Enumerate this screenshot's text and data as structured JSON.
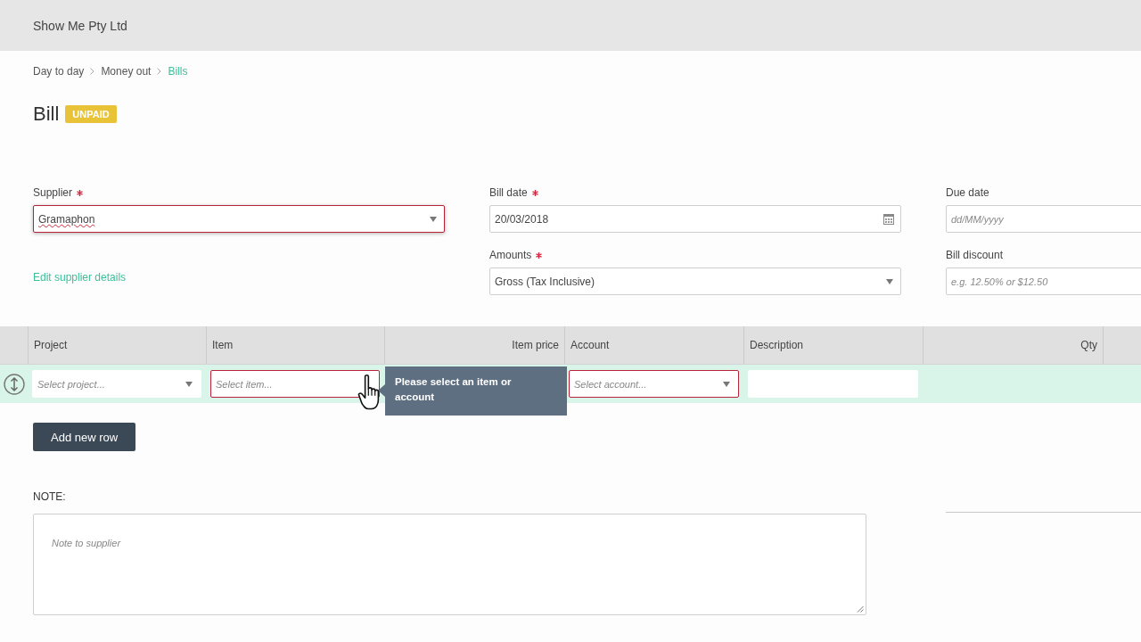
{
  "header": {
    "company": "Show Me Pty Ltd"
  },
  "breadcrumb": [
    {
      "label": "Day to day",
      "current": false
    },
    {
      "label": "Money out",
      "current": false
    },
    {
      "label": "Bills",
      "current": true
    }
  ],
  "title": "Bill",
  "status_badge": "UNPAID",
  "supplier": {
    "label": "Supplier",
    "required": true,
    "value": "Gramaphon",
    "invalid": true,
    "focused": true,
    "misspelled": true
  },
  "edit_supplier_link": "Edit supplier details",
  "details": [
    {
      "label": "Bill date",
      "required": true,
      "kind": "date",
      "value": "20/03/2018"
    },
    {
      "label": "Due date",
      "kind": "text",
      "placeholder": "dd/MM/yyyy"
    },
    {
      "label": "Amounts",
      "required": true,
      "kind": "select",
      "value": "Gross (Tax Inclusive)"
    },
    {
      "label": "Bill discount",
      "kind": "text",
      "placeholder": "e.g. 12.50% or $12.50"
    }
  ],
  "table": {
    "columns": [
      {
        "label": "Project",
        "kind": "text"
      },
      {
        "label": "Item",
        "kind": "text"
      },
      {
        "label": "Item price",
        "kind": "number"
      },
      {
        "label": "Account",
        "kind": "text"
      },
      {
        "label": "Description",
        "kind": "text"
      },
      {
        "label": "Qty",
        "kind": "number"
      }
    ],
    "rows": [
      {
        "selected": true,
        "cells": [
          {
            "kind": "select",
            "placeholder": "Select project...",
            "invalid": false,
            "hovered": false
          },
          {
            "kind": "select",
            "placeholder": "Select item...",
            "invalid": true,
            "hovered": true,
            "tooltip": "Please select an item or account"
          },
          {
            "kind": "empty"
          },
          {
            "kind": "select",
            "placeholder": "Select account...",
            "invalid": true,
            "hovered": false
          },
          {
            "kind": "input"
          },
          {
            "kind": "empty"
          }
        ]
      }
    ]
  },
  "add_row_button": "Add new row",
  "note": {
    "label": "NOTE:",
    "placeholder": "Note to supplier"
  }
}
